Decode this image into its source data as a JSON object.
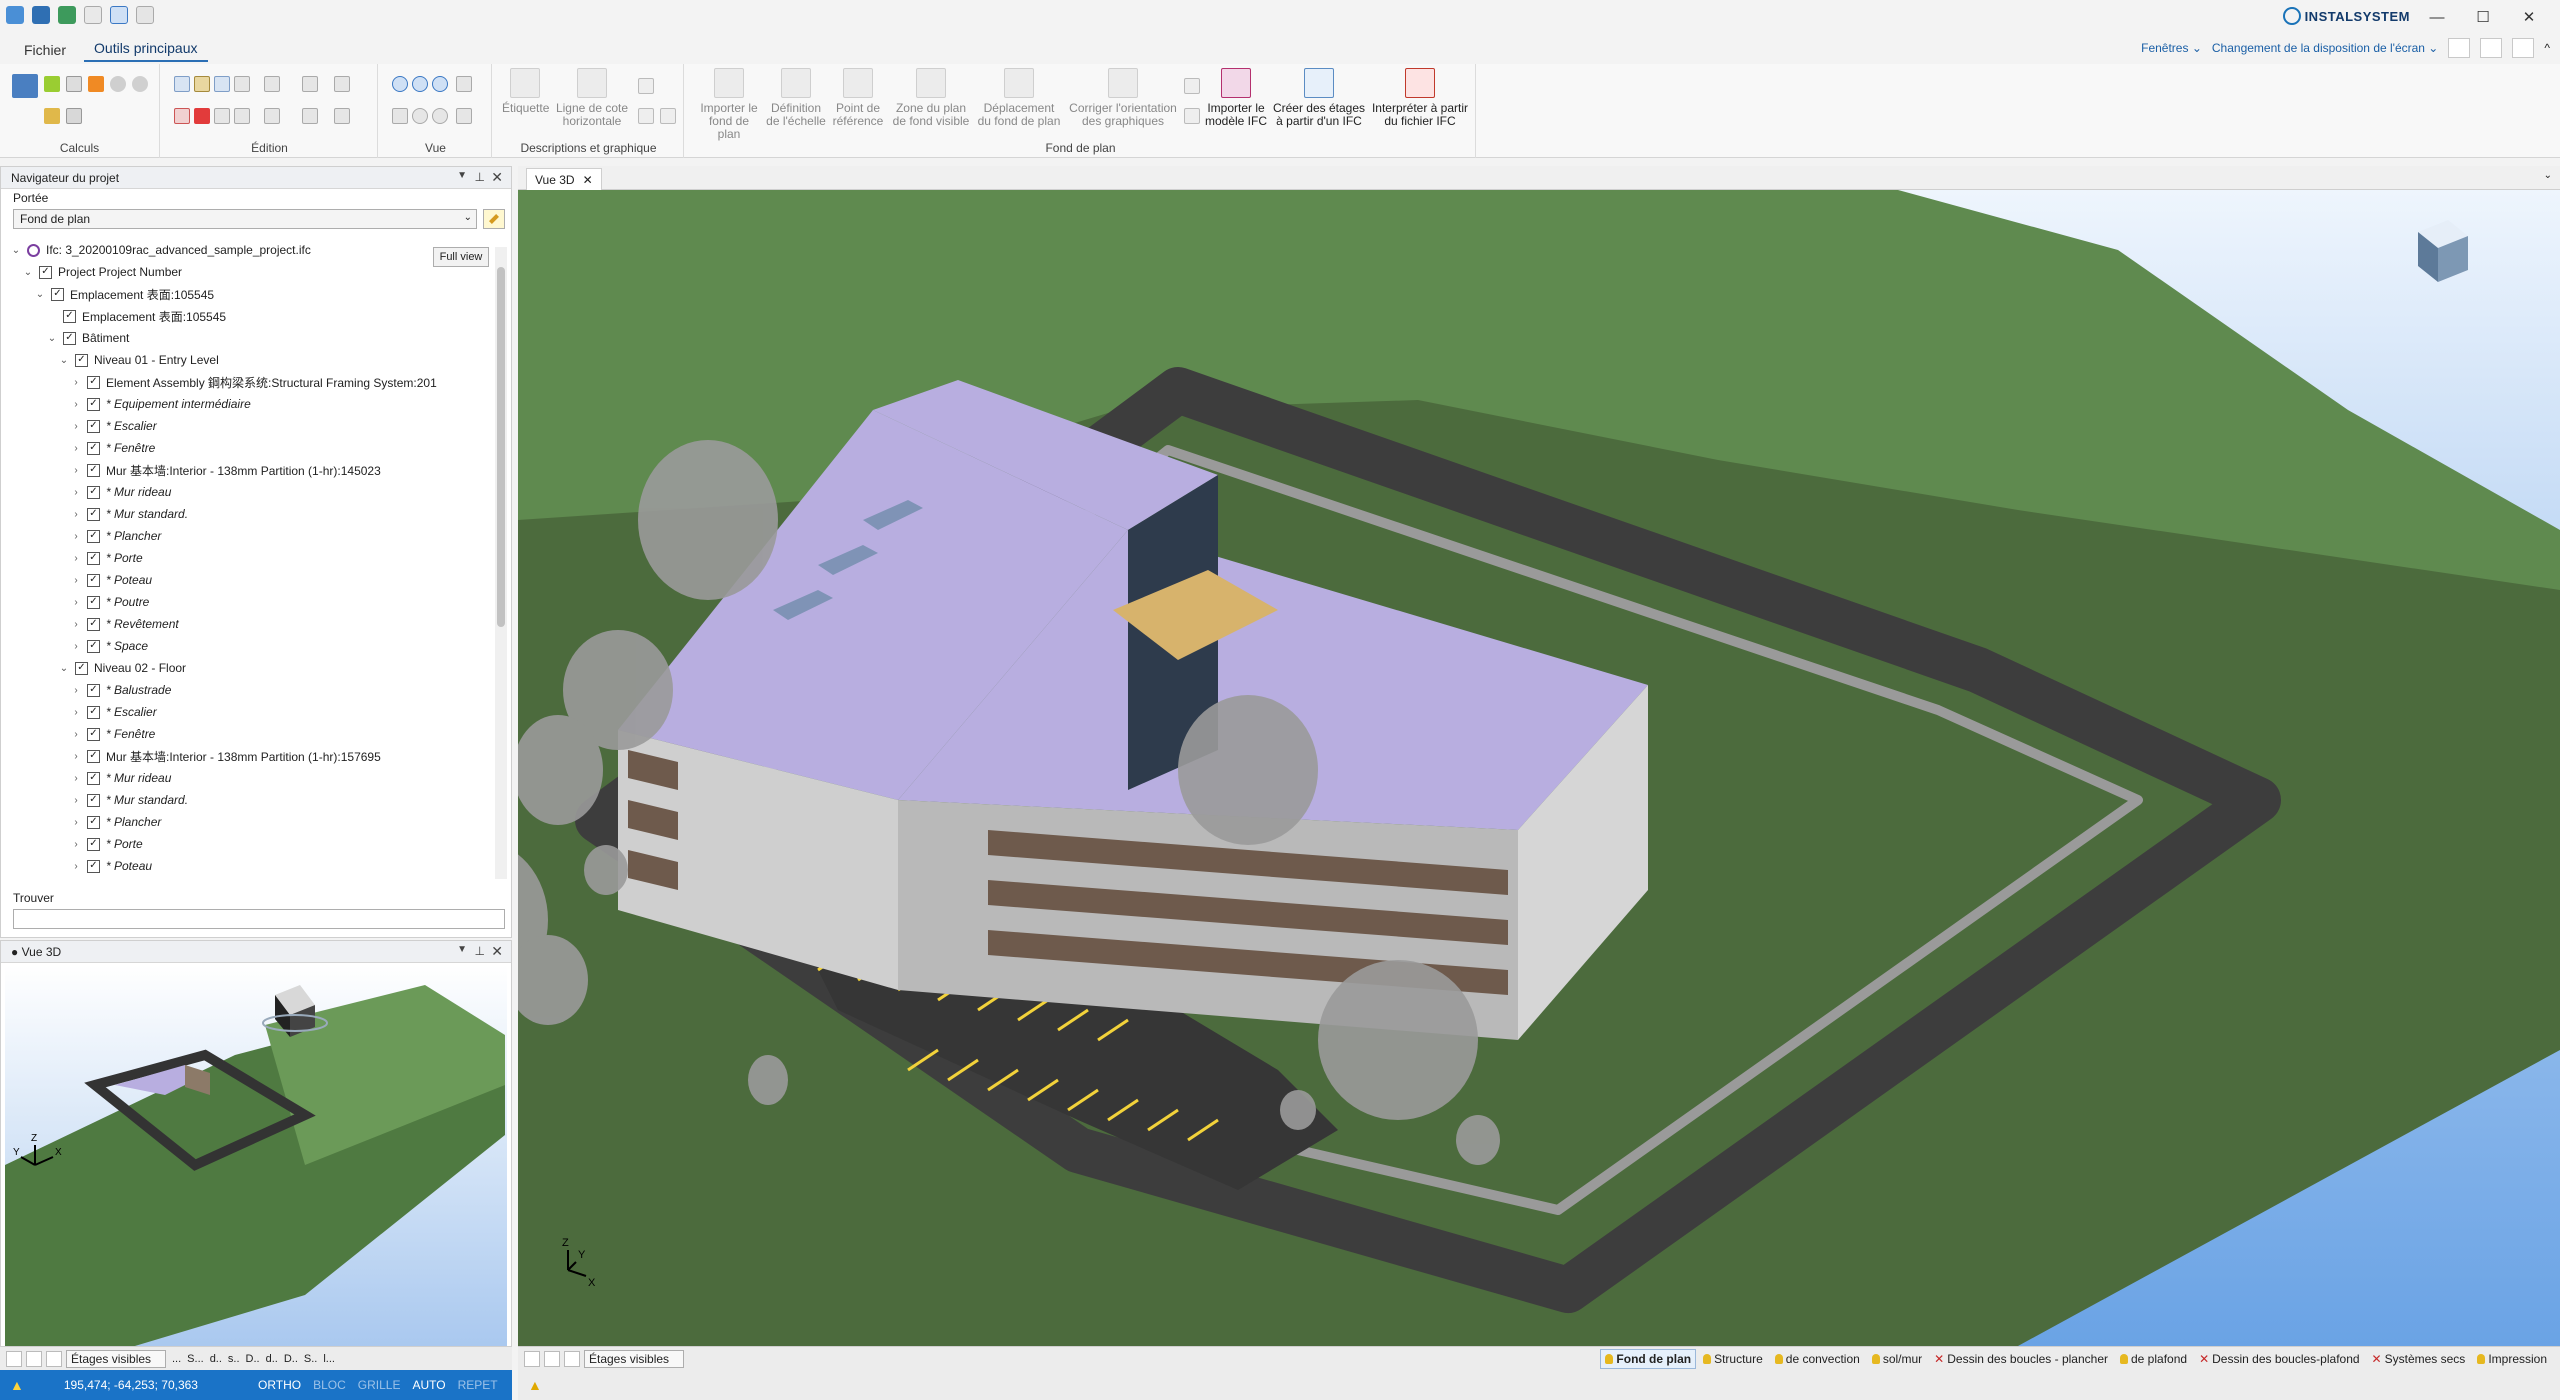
{
  "app": {
    "brand": "INSTALSYSTEM"
  },
  "window_controls": [
    "—",
    "☐",
    "✕"
  ],
  "tabs": {
    "file": "Fichier",
    "main_tools": "Outils principaux"
  },
  "header_right": {
    "windows": "Fenêtres ⌄",
    "layout": "Changement de la disposition de l'écran ⌄"
  },
  "ribbon": {
    "groups": {
      "calculs": "Calculs",
      "edition": "Édition",
      "vue": "Vue",
      "descriptions": "Descriptions et graphique",
      "fond": "Fond de plan"
    },
    "buttons": {
      "etiquette": "Étiquette",
      "ligne_cote": "Ligne de cote horizontale",
      "importer_fond": "Importer le fond de plan",
      "definition_echelle": "Définition de l'échelle",
      "point_reference": "Point de référence",
      "zone_plan": "Zone du plan de fond visible",
      "deplacement": "Déplacement du fond de plan",
      "corriger": "Corriger l'orientation des graphiques",
      "importer_ifc": "Importer le modèle IFC",
      "creer_etages": "Créer des étages à partir d'un IFC",
      "interpreter": "Interpréter à partir du fichier IFC"
    }
  },
  "navigator": {
    "title": "Navigateur du projet",
    "scope_label": "Portée",
    "scope_value": "Fond de plan",
    "full_view": "Full view",
    "find_label": "Trouver",
    "tree": [
      {
        "indent": 0,
        "label": "Ifc: 3_20200109rac_advanced_sample_project.ifc",
        "italic": false,
        "chev": "⌄",
        "check": false
      },
      {
        "indent": 1,
        "label": "Project  Project Number",
        "italic": false,
        "chev": "⌄",
        "check": true
      },
      {
        "indent": 2,
        "label": "Emplacement  表面:105545",
        "italic": false,
        "chev": "⌄",
        "check": true
      },
      {
        "indent": 3,
        "label": "Emplacement  表面:105545",
        "italic": false,
        "chev": "",
        "check": true
      },
      {
        "indent": 3,
        "label": "Bâtiment",
        "italic": false,
        "chev": "⌄",
        "check": true
      },
      {
        "indent": 4,
        "label": "Niveau  01 - Entry Level",
        "italic": false,
        "chev": "⌄",
        "check": true
      },
      {
        "indent": 5,
        "label": "Element Assembly  鋼构梁系统:Structural Framing System:201",
        "italic": false,
        "chev": "›",
        "check": true
      },
      {
        "indent": 5,
        "label": "* Equipement intermédiaire",
        "italic": true,
        "chev": "›",
        "check": true
      },
      {
        "indent": 5,
        "label": "* Escalier",
        "italic": true,
        "chev": "›",
        "check": true
      },
      {
        "indent": 5,
        "label": "* Fenêtre",
        "italic": true,
        "chev": "›",
        "check": true
      },
      {
        "indent": 5,
        "label": "Mur  基本墙:Interior - 138mm Partition (1-hr):145023",
        "italic": false,
        "chev": "›",
        "check": true
      },
      {
        "indent": 5,
        "label": "* Mur rideau",
        "italic": true,
        "chev": "›",
        "check": true
      },
      {
        "indent": 5,
        "label": "* Mur standard.",
        "italic": true,
        "chev": "›",
        "check": true
      },
      {
        "indent": 5,
        "label": "* Plancher",
        "italic": true,
        "chev": "›",
        "check": true
      },
      {
        "indent": 5,
        "label": "* Porte",
        "italic": true,
        "chev": "›",
        "check": true
      },
      {
        "indent": 5,
        "label": "* Poteau",
        "italic": true,
        "chev": "›",
        "check": true
      },
      {
        "indent": 5,
        "label": "* Poutre",
        "italic": true,
        "chev": "›",
        "check": true
      },
      {
        "indent": 5,
        "label": "* Revêtement",
        "italic": true,
        "chev": "›",
        "check": true
      },
      {
        "indent": 5,
        "label": "* Space",
        "italic": true,
        "chev": "›",
        "check": true
      },
      {
        "indent": 4,
        "label": "Niveau  02 - Floor",
        "italic": false,
        "chev": "⌄",
        "check": true
      },
      {
        "indent": 5,
        "label": "* Balustrade",
        "italic": true,
        "chev": "›",
        "check": true
      },
      {
        "indent": 5,
        "label": "* Escalier",
        "italic": true,
        "chev": "›",
        "check": true
      },
      {
        "indent": 5,
        "label": "* Fenêtre",
        "italic": true,
        "chev": "›",
        "check": true
      },
      {
        "indent": 5,
        "label": "Mur  基本墙:Interior - 138mm Partition (1-hr):157695",
        "italic": false,
        "chev": "›",
        "check": true
      },
      {
        "indent": 5,
        "label": "* Mur rideau",
        "italic": true,
        "chev": "›",
        "check": true
      },
      {
        "indent": 5,
        "label": "* Mur standard.",
        "italic": true,
        "chev": "›",
        "check": true
      },
      {
        "indent": 5,
        "label": "* Plancher",
        "italic": true,
        "chev": "›",
        "check": true
      },
      {
        "indent": 5,
        "label": "* Porte",
        "italic": true,
        "chev": "›",
        "check": true
      },
      {
        "indent": 5,
        "label": "* Poteau",
        "italic": true,
        "chev": "›",
        "check": true
      }
    ]
  },
  "mini_view": {
    "title": "● Vue 3D"
  },
  "main_view": {
    "tab": "Vue 3D"
  },
  "bottom_left": {
    "visible_floors": "Étages visibles",
    "chips": [
      "...",
      "S...",
      "d..",
      "s..",
      "D..",
      "d..",
      "D..",
      "S..",
      "l..."
    ]
  },
  "bottom_right": {
    "visible_floors": "Étages visibles",
    "layers": [
      {
        "label": "Fond de plan",
        "icon": "bulb",
        "active": true
      },
      {
        "label": "Structure",
        "icon": "bulb",
        "active": false
      },
      {
        "label": "de convection",
        "icon": "bulb",
        "active": false
      },
      {
        "label": "sol/mur",
        "icon": "bulb",
        "active": false
      },
      {
        "label": "Dessin des boucles - plancher",
        "icon": "cross",
        "active": false
      },
      {
        "label": "de plafond",
        "icon": "bulb",
        "active": false
      },
      {
        "label": "Dessin des boucles-plafond",
        "icon": "cross",
        "active": false
      },
      {
        "label": "Systèmes secs",
        "icon": "cross",
        "active": false
      },
      {
        "label": "Impression",
        "icon": "bulb",
        "active": false
      }
    ]
  },
  "status": {
    "coords": "195,474; -64,253; 70,363",
    "ortho": "ORTHO",
    "bloc": "BLOC",
    "grille": "GRILLE",
    "auto": "AUTO",
    "repet": "REPET"
  },
  "colors": {
    "accent": "#1a73c7",
    "grass": "#4c6b3d",
    "hill": "#5f8a4f",
    "roof": "#b8aee0",
    "road": "#3d3d3d",
    "sky": "#7fb0ea"
  }
}
